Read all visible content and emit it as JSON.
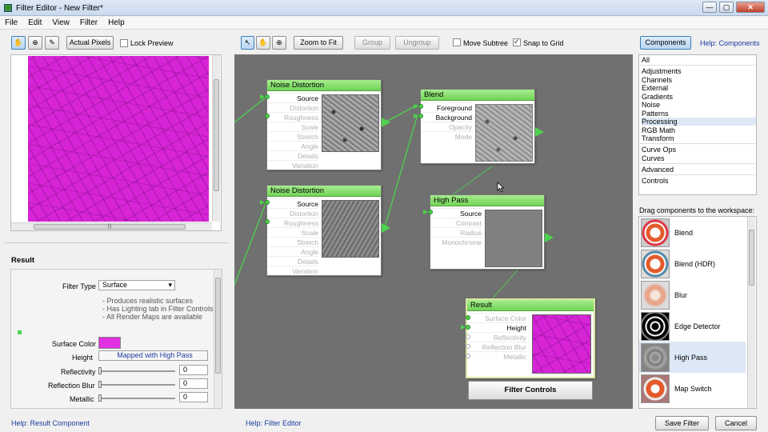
{
  "window": {
    "title": "Filter Editor - New Filter*",
    "min": "—",
    "max": "▢",
    "close": "✕"
  },
  "menu": [
    "File",
    "Edit",
    "View",
    "Filter",
    "Help"
  ],
  "left_toolbar": {
    "actual_pixels": "Actual Pixels",
    "lock_preview": "Lock Preview"
  },
  "canvas_toolbar": {
    "zoom_to_fit": "Zoom to Fit",
    "group": "Group",
    "ungroup": "Ungroup",
    "move_subtree": "Move Subtree",
    "snap_to_grid": "Snap to Grid"
  },
  "right_toolbar": {
    "components": "Components",
    "help_components": "Help: Components"
  },
  "preview": {
    "scroll_grip": "|||"
  },
  "result_panel": {
    "title": "Result",
    "filter_type_label": "Filter Type",
    "filter_type_value": "Surface",
    "notes": [
      "- Produces realistic surfaces",
      "- Has Lighting tab in Filter Controls",
      "- All Render Maps are available"
    ],
    "surface_color_label": "Surface Color",
    "surface_color": "#e030e0",
    "height_label": "Height",
    "height_value": "Mapped with High Pass",
    "reflectivity_label": "Reflectivity",
    "reflectivity_value": "0",
    "reflection_blur_label": "Reflection Blur",
    "reflection_blur_value": "0",
    "metallic_label": "Metallic",
    "metallic_value": "0"
  },
  "nodes": {
    "noise1": {
      "title": "Noise Distortion",
      "rows": [
        "Source",
        "Distortion",
        "Roughness",
        "Scale",
        "Stretch",
        "Angle",
        "Details",
        "Variation"
      ]
    },
    "noise2": {
      "title": "Noise Distortion",
      "rows": [
        "Source",
        "Distortion",
        "Roughness",
        "Scale",
        "Stretch",
        "Angle",
        "Details",
        "Variation"
      ]
    },
    "blend": {
      "title": "Blend",
      "rows": [
        "Foreground",
        "Background",
        "Opacity",
        "Mode"
      ]
    },
    "highpass": {
      "title": "High Pass",
      "rows": [
        "Source",
        "Contrast",
        "Radius",
        "Monochrome"
      ]
    },
    "result": {
      "title": "Result",
      "rows": [
        "Surface Color",
        "Height",
        "Reflectivity",
        "Reflection Blur",
        "Metallic"
      ]
    },
    "filter_controls": "Filter Controls"
  },
  "categories": [
    "All",
    "Adjustments",
    "Channels",
    "External",
    "Gradients",
    "Noise",
    "Patterns",
    "Processing",
    "RGB Math",
    "Transform",
    "Curve Ops",
    "Curves",
    "Advanced",
    "Controls"
  ],
  "selected_category": "Processing",
  "drag_hint": "Drag components to the workspace:",
  "components": [
    "Blend",
    "Blend (HDR)",
    "Blur",
    "Edge Detector",
    "High Pass",
    "Map Switch"
  ],
  "footer": {
    "help_result": "Help: Result Component",
    "help_editor": "Help: Filter Editor",
    "save": "Save Filter",
    "cancel": "Cancel"
  },
  "colors": {
    "node_header": "#7fdc64",
    "port_green": "#4ed24e",
    "canvas": "#707070",
    "magenta": "#d624d6",
    "link": "#1b3a9c"
  }
}
